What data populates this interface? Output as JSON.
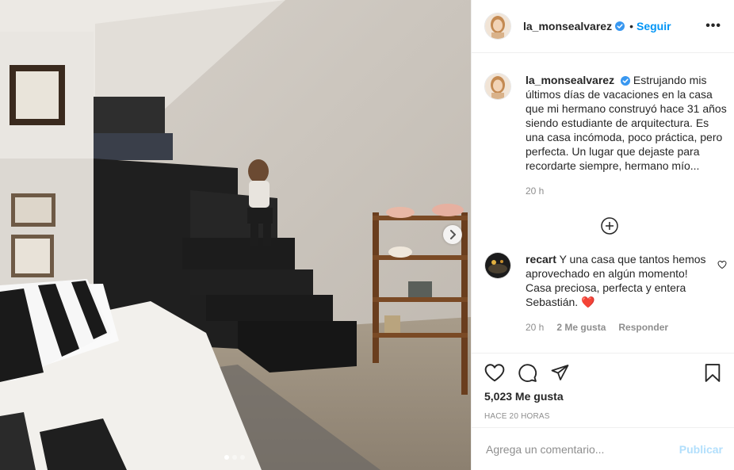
{
  "post": {
    "author": "la_monsealvarez",
    "follow_label": "Seguir",
    "bullet": "•",
    "more_label": "•••",
    "caption_text": "Estrujando mis últimos días de vacaciones en la casa que mi hermano construyó hace 31 años siendo estudiante de arquitectura. Es una casa incómoda, poco práctica, pero perfecta. Un lugar que dejaste para recordarte siempre, hermano mío...",
    "caption_time": "20 h",
    "likes": "5,023 Me gusta",
    "posted_ago": "Hace 20 horas"
  },
  "comments": [
    {
      "username": "recart",
      "text": "Y una casa que tantos hemos aprovechado en algún momento! Casa preciosa, perfecta y entera Sebastián. ❤️",
      "time": "20 h",
      "likes": "2 Me gusta",
      "reply": "Responder"
    }
  ],
  "add_comment": {
    "placeholder": "Agrega un comentario...",
    "publish_label": "Publicar"
  },
  "carousel": {
    "slides": 3,
    "active": 1
  },
  "colors": {
    "accent": "#0095f6",
    "text": "#262626",
    "muted": "#8e8e8e",
    "publish_disabled": "#b2dffc",
    "verified": "#3897f0"
  },
  "icons": [
    "verified-badge-icon",
    "more-options-icon",
    "add-circle-icon",
    "heart-icon",
    "comment-icon",
    "share-icon",
    "bookmark-icon",
    "next-arrow-icon"
  ]
}
